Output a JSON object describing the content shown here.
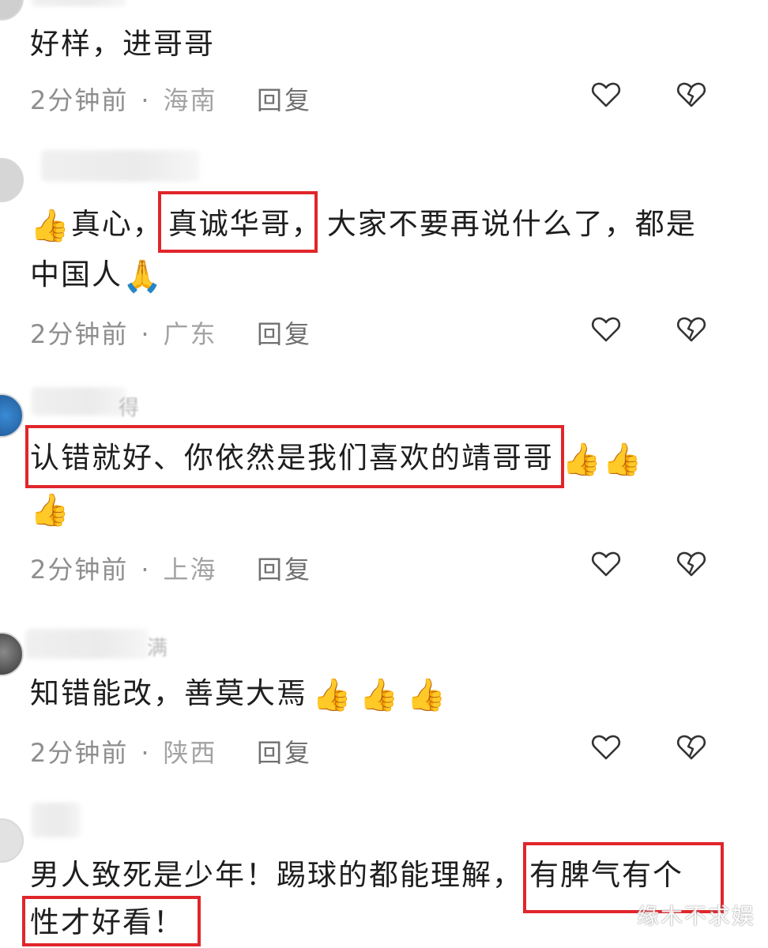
{
  "comments": [
    {
      "text": "好样，进哥哥",
      "time": "2分钟前",
      "separator": "·",
      "location": "海南",
      "reply_label": "回复"
    },
    {
      "username_fragment": "",
      "line1_pre": "真心，",
      "line1_highlight": "真诚华哥，",
      "line1_post": "大家不要再说什么了，都是",
      "line2": "中国人",
      "time": "2分钟前",
      "separator": "·",
      "location": "广东",
      "reply_label": "回复"
    },
    {
      "username_fragment": "得",
      "highlight": "认错就好、你依然是我们喜欢的靖哥哥",
      "time": "2分钟前",
      "separator": "·",
      "location": "上海",
      "reply_label": "回复"
    },
    {
      "username_fragment": "满",
      "text": "知错能改，善莫大焉",
      "time": "2分钟前",
      "separator": "·",
      "location": "陕西",
      "reply_label": "回复"
    },
    {
      "line1_pre": "男人致死是少年！踢球的都能理解，",
      "line1_highlight": "有脾气有个",
      "line2_highlight": "性才好看！"
    }
  ],
  "icons": {
    "thumb": "👍",
    "pray": "🙏",
    "like": "heart-outline-icon",
    "dislike": "broken-heart-icon"
  },
  "colors": {
    "highlight_border": "#e0262b",
    "meta_text": "#8e8e8e"
  },
  "watermark": "缘木不求娱"
}
